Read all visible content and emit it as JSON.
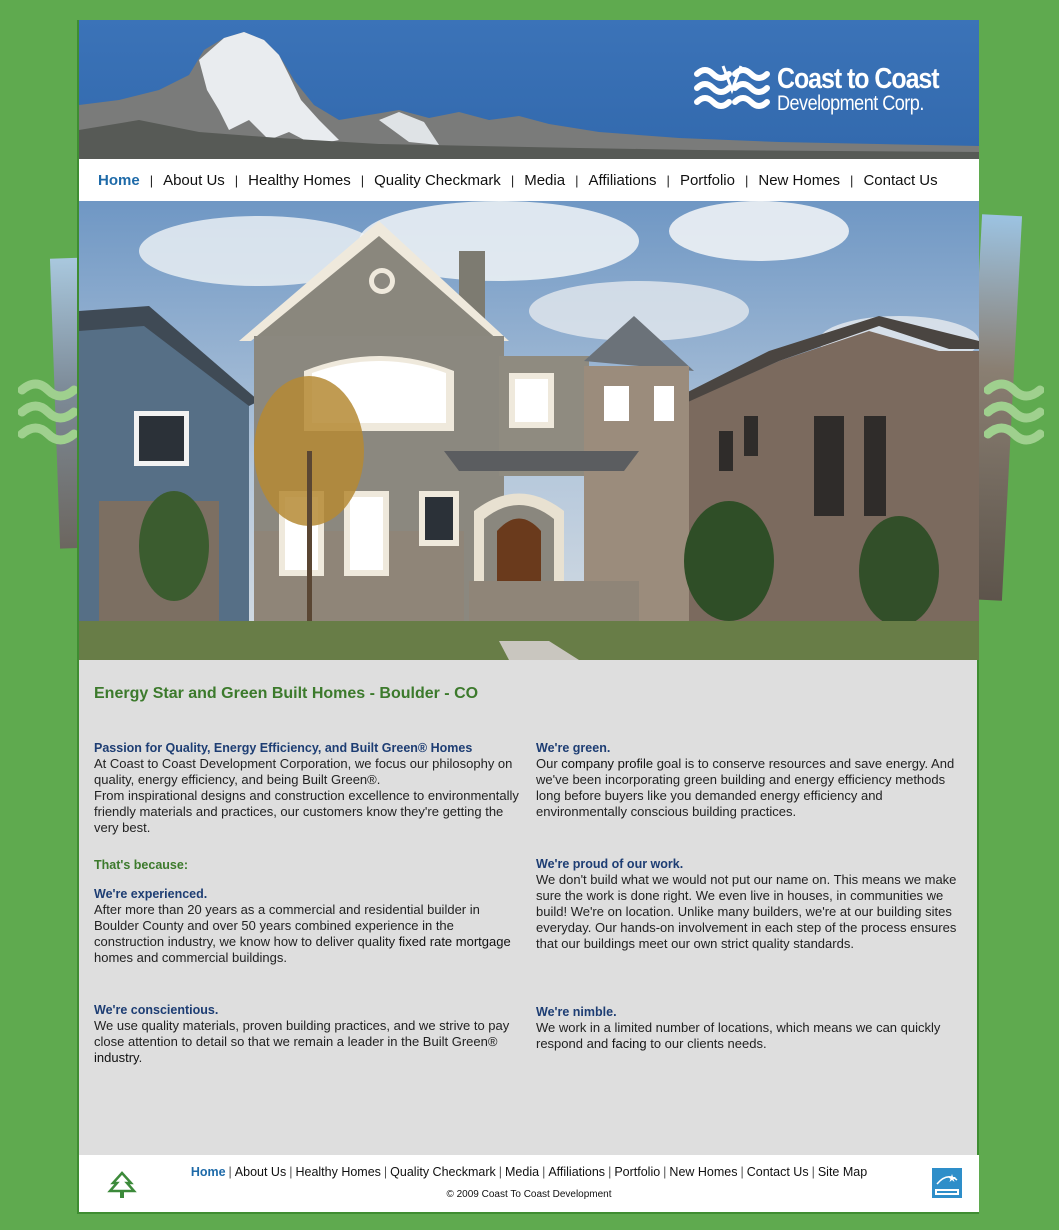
{
  "brand": {
    "name_line1": "Coast to Coast",
    "name_line2": "Development Corp."
  },
  "nav": {
    "items": [
      {
        "label": "Home",
        "active": true
      },
      {
        "label": "About Us"
      },
      {
        "label": "Healthy Homes"
      },
      {
        "label": "Quality Checkmark"
      },
      {
        "label": "Media"
      },
      {
        "label": "Affiliations"
      },
      {
        "label": "Portfolio"
      },
      {
        "label": "New Homes"
      },
      {
        "label": "Contact Us"
      }
    ],
    "separator": "|"
  },
  "main": {
    "title": "Energy Star and Green Built Homes - Boulder - CO",
    "left": {
      "passion_heading": "Passion for Quality, Energy Efficiency, and Built Green® Homes",
      "passion_p1": "At Coast to Coast Development Corporation, we focus our philosophy on quality, energy efficiency, and being Built Green®.",
      "passion_p2": "From inspirational designs and construction excellence to environmentally friendly materials and practices, our customers know they're getting the very best.",
      "because_heading": "That's because:",
      "experienced_heading": "We're experienced.",
      "experienced_text_a": "After more than 20 years as a commercial and residential builder in Boulder County and over 50 years combined experience in the construction industry, we know how to deliver quality ",
      "experienced_link": "fixed rate mortgage",
      "experienced_text_b": " homes and commercial buildings.",
      "conscientious_heading": "We're conscientious.",
      "conscientious_text_a": "We use quality materials, proven building practices, and we strive to pay close attention to detail so that we remain a leader in the Built Green® ",
      "conscientious_link": "industry",
      "conscientious_text_b": "."
    },
    "right": {
      "green_heading": "We're green.",
      "green_text_a": "Our ",
      "green_link": "company profile",
      "green_text_b": " goal is to conserve resources and save energy. And we've been incorporating green building and energy efficiency methods long before buyers like you demanded energy efficiency and environmentally conscious building practices.",
      "proud_heading": "We're proud of our work.",
      "proud_text": "We don't build what we would not put our name on. This means we make sure the work is done right. We even live in houses, in communities we build! We're on location. Unlike many builders, we're at our building sites everyday. Our hands-on involvement in each step of the process ensures that our buildings meet our own strict quality standards.",
      "nimble_heading": "We're nimble.",
      "nimble_text_a": "We work in a limited number of locations, which means we can quickly respond and ",
      "nimble_link": "facing",
      "nimble_text_b": " to our clients needs."
    }
  },
  "footer": {
    "links": [
      "Home",
      "About Us",
      "Healthy Homes",
      "Quality Checkmark",
      "Media",
      "Affiliations",
      "Portfolio",
      "New Homes",
      "Contact Us",
      "Site Map"
    ],
    "separator": "|",
    "copyright": "© 2009 Coast To Coast Development"
  },
  "colors": {
    "background_green": "#5faa4f",
    "header_blue": "#3b73b8",
    "active_link_blue": "#1e6aa8",
    "heading_navy": "#1d3d73",
    "title_green": "#3c7a2c",
    "content_gray": "#dedede"
  },
  "icons": [
    "coast-to-coast-wave-logo-icon",
    "tree-icon",
    "energy-star-icon",
    "wave-icon"
  ]
}
